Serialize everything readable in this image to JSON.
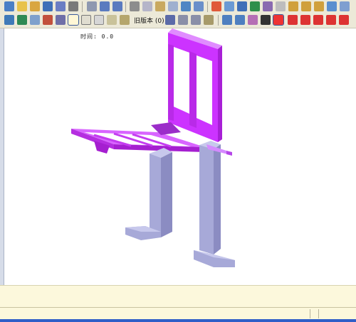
{
  "toolbar": {
    "old_version_label": "旧版本 (0)"
  },
  "viewport": {
    "time_label": "时间: 0.0"
  },
  "colors": {
    "toolbar_bg": "#ece9d8",
    "model_magenta": "#cc33ff",
    "model_grey": "#a7a9d8",
    "panel_bg": "#fcf8dc"
  }
}
